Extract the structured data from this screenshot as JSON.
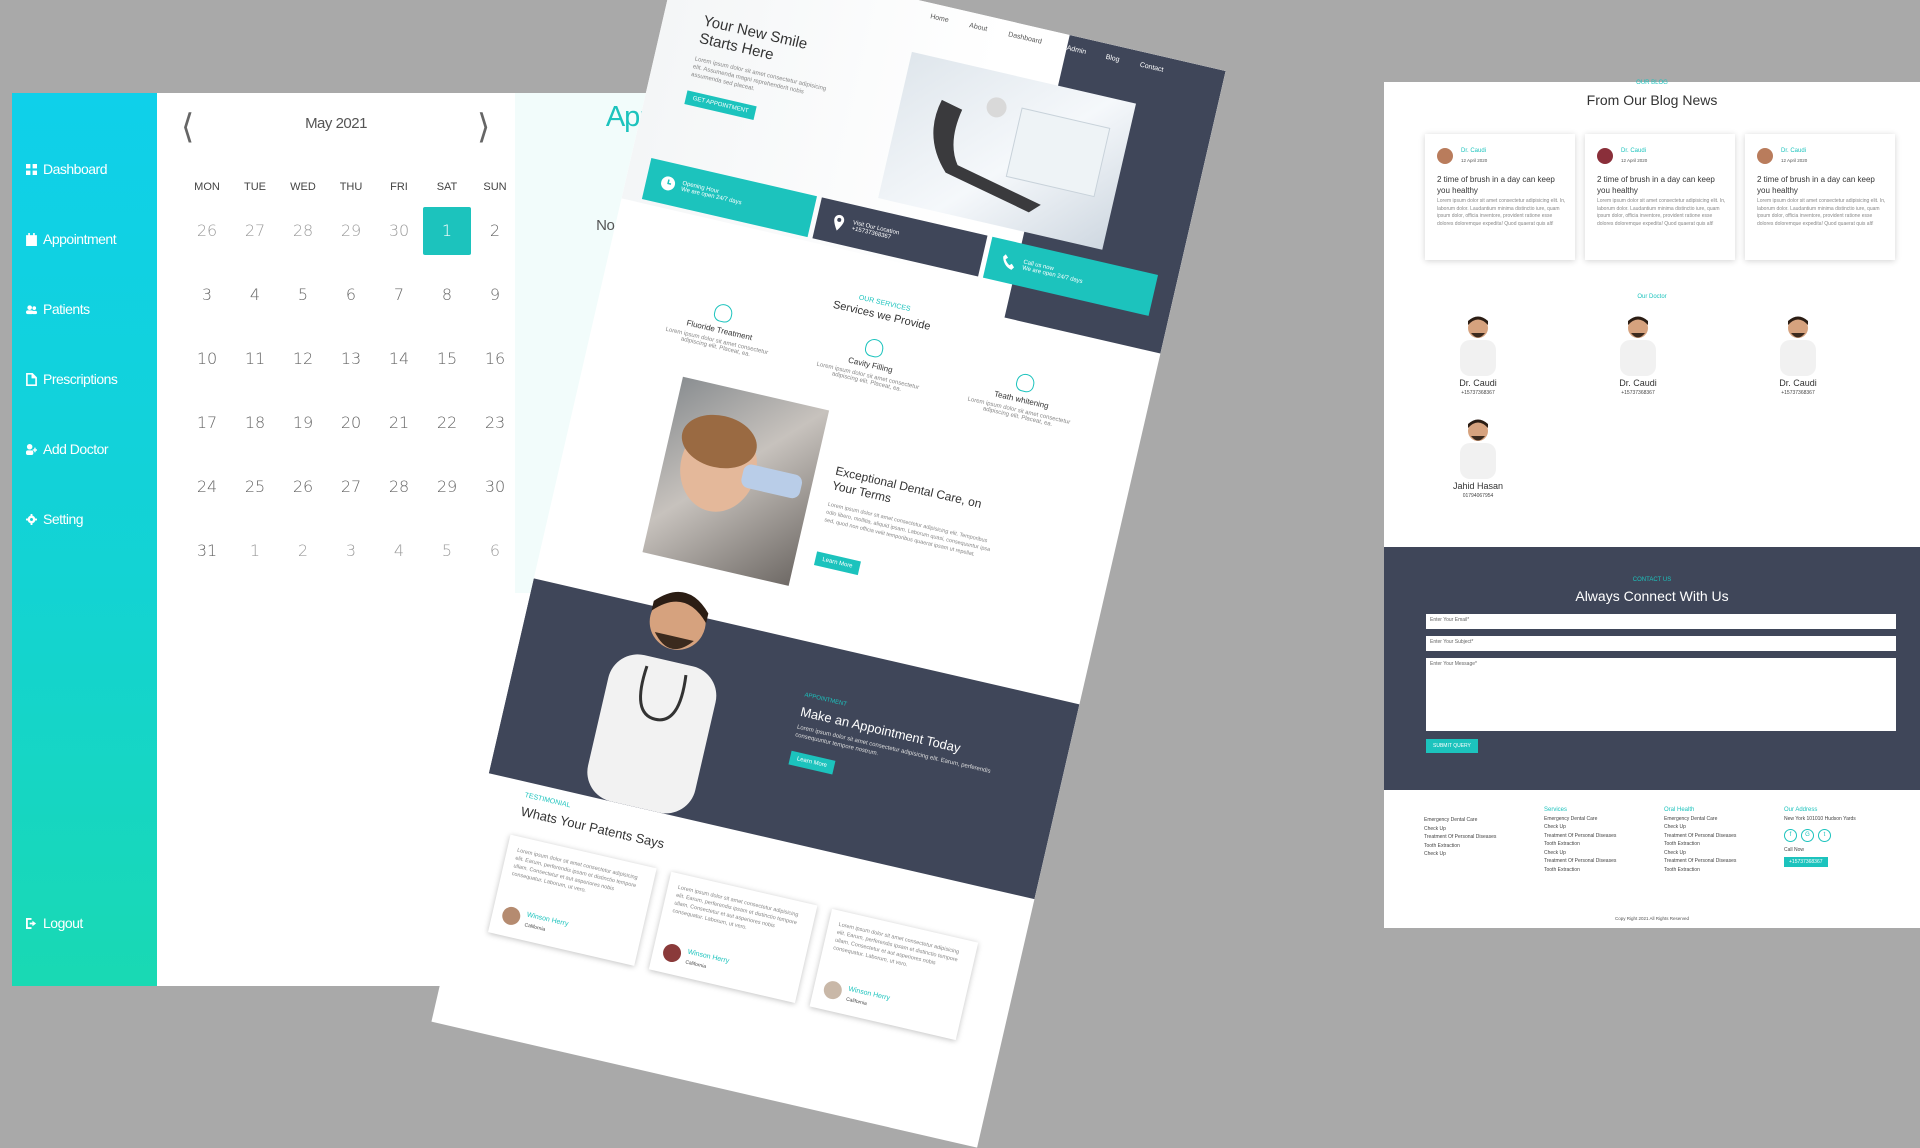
{
  "dashboard": {
    "sidebar": {
      "items": [
        {
          "label": "Dashboard",
          "icon": "grid-icon"
        },
        {
          "label": "Appointment",
          "icon": "calendar-icon"
        },
        {
          "label": "Patients",
          "icon": "users-icon"
        },
        {
          "label": "Prescriptions",
          "icon": "file-icon"
        },
        {
          "label": "Add Doctor",
          "icon": "user-plus-icon"
        },
        {
          "label": "Setting",
          "icon": "gear-icon"
        }
      ],
      "logout": "Logout"
    },
    "calendar": {
      "month": "May 2021",
      "prev": "⟨",
      "next": "⟩",
      "weekdays": [
        "MON",
        "TUE",
        "WED",
        "THU",
        "FRI",
        "SAT",
        "SUN"
      ],
      "weeks": [
        [
          "26",
          "27",
          "28",
          "29",
          "30",
          "1",
          "2"
        ],
        [
          "3",
          "4",
          "5",
          "6",
          "7",
          "8",
          "9"
        ],
        [
          "10",
          "11",
          "12",
          "13",
          "14",
          "15",
          "16"
        ],
        [
          "17",
          "18",
          "19",
          "20",
          "21",
          "22",
          "23"
        ],
        [
          "24",
          "25",
          "26",
          "27",
          "28",
          "29",
          "30"
        ],
        [
          "31",
          "1",
          "2",
          "3",
          "4",
          "5",
          "6"
        ]
      ],
      "selected": "1"
    },
    "appointments": {
      "title": "Appointments",
      "empty": "No Appointments for this Date"
    }
  },
  "landing": {
    "nav": [
      "Home",
      "About",
      "Dashboard",
      "Admin",
      "Blog",
      "Contact"
    ],
    "hero": {
      "title": "Your New Smile Starts Here",
      "text": "Lorem ipsum dolor sit amet consectetur adipisicing elit. Assumenda magni reprehenderit nobis assumenda sed placeat.",
      "button": "GET APPOINTMENT"
    },
    "info": [
      {
        "title": "Opening Hour",
        "sub": "We are open 24/7 days"
      },
      {
        "title": "Visit Our Location",
        "sub": "+15737368367"
      },
      {
        "title": "Call us now",
        "sub": "We are open 24/7 days"
      }
    ],
    "services": {
      "kicker": "OUR SERVICES",
      "title": "Services we Provide",
      "items": [
        {
          "name": "Fluoride Treatment",
          "desc": "Lorem ipsum dolor sit amet consectetur adipiscing elit. Placeat, ea."
        },
        {
          "name": "Cavity Filling",
          "desc": "Lorem ipsum dolor sit amet consectetur adipiscing elit. Placeat, ea."
        },
        {
          "name": "Teath whitening",
          "desc": "Lorem ipsum dolor sit amet consectetur adipiscing elit. Placeat, ea."
        }
      ]
    },
    "feature": {
      "title": "Exceptional Dental Care, on Your Terms",
      "text": "Lorem ipsum dolor sit amet consectetur adipisicing elit. Temporibus odio libero, mollitia, aliquid ipsam. Laborum quasi, consequuntur ipsa sed, quod non officia velit temporibus quaerat ipsam ut repellat.",
      "button": "Learn More"
    },
    "appointment": {
      "kicker": "APPOINTMENT",
      "title": "Make an Appointment Today",
      "text": "Lorem ipsum dolor sit amet consectetur adipisicing elit. Earum, perferendis consequuntur tempore nostrum.",
      "button": "Learn More"
    },
    "testimonial": {
      "kicker": "TESTIMONIAL",
      "title": "Whats Your Patents Says",
      "items": [
        {
          "text": "Lorem ipsum dolor sit amet consectetur adipisicing elit. Earum, perferendis ipsam et distinctio tempore ullam. Consectetur et aut asperiores nobis consequatur. Laborum, ut vero.",
          "name": "Winson Herry",
          "loc": "California"
        },
        {
          "text": "Lorem ipsum dolor sit amet consectetur adipisicing elit. Earum, perferendis ipsam et distinctio tempore ullam. Consectetur et aut asperiores nobis consequatur. Laborum, ut vero.",
          "name": "Winson Herry",
          "loc": "California"
        },
        {
          "text": "Lorem ipsum dolor sit amet consectetur adipisicing elit. Earum, perferendis ipsam et distinctio tempore ullam. Consectetur et aut asperiores nobis consequatur. Laborum, ut vero.",
          "name": "Winson Herry",
          "loc": "California"
        }
      ]
    }
  },
  "site": {
    "blog": {
      "kicker": "OUR BLOG",
      "title": "From Our Blog News",
      "posts": [
        {
          "author": "Dr. Caudi",
          "date": "12 April 2020",
          "title": "2 time of brush in a day can keep you healthy",
          "body": "Lorem ipsum dolor sit amet consectetur adipisicing elit. In, laborum dolor. Laudantium minima distinctio iure, quam ipsum dolor, officia inventore, provident ratione esse dolores doloremque expedita! Quod quaerat quis alt!"
        },
        {
          "author": "Dr. Caudi",
          "date": "12 April 2020",
          "title": "2 time of brush in a day can keep you healthy",
          "body": "Lorem ipsum dolor sit amet consectetur adipisicing elit. In, laborum dolor. Laudantium minima distinctio iure, quam ipsum dolor, officia inventore, provident ratione esse dolores doloremque expedita! Quod quaerat quis alt!"
        },
        {
          "author": "Dr. Caudi",
          "date": "12 April 2020",
          "title": "2 time of brush in a day can keep you healthy",
          "body": "Lorem ipsum dolor sit amet consectetur adipisicing elit. In, laborum dolor. Laudantium minima distinctio iure, quam ipsum dolor, officia inventore, provident ratione esse dolores doloremque expedita! Quod quaerat quis alt!"
        }
      ]
    },
    "doctors": {
      "kicker": "Our Doctor",
      "items": [
        {
          "name": "Dr. Caudi",
          "phone": "+15737368367"
        },
        {
          "name": "Dr. Caudi",
          "phone": "+15737368367"
        },
        {
          "name": "Dr. Caudi",
          "phone": "+15737368367"
        },
        {
          "name": "Jahid Hasan",
          "phone": "01794067954"
        }
      ]
    },
    "contact": {
      "kicker": "CONTACT US",
      "title": "Always Connect With Us",
      "email_ph": "Enter Your Email*",
      "subject_ph": "Enter Your Subject*",
      "message_ph": "Enter Your Message*",
      "submit": "SUBMIT QUERY"
    },
    "footer": {
      "col1": [
        "Emergency Dental Care",
        "Check Up",
        "Treatment Of Personal Diseases",
        "Tooth Extraction",
        "Check Up"
      ],
      "services_title": "Services",
      "services": [
        "Emergency Dental Care",
        "Check Up",
        "Treatment Of Personal Diseases",
        "Tooth Extraction",
        "Check Up",
        "Treatment Of Personal Diseases",
        "Tooth Extraction"
      ],
      "oral_title": "Oral Health",
      "oral": [
        "Emergency Dental Care",
        "Check Up",
        "Treatment Of Personal Diseases",
        "Tooth Extraction",
        "Check Up",
        "Treatment Of Personal Diseases",
        "Tooth Extraction"
      ],
      "address_title": "Our Address",
      "address": "New York 101010 Hudson Yards",
      "social": [
        "f",
        "G",
        "t"
      ],
      "call_label": "Call Now",
      "call_button": "+15737368367",
      "copyright": "Copy Right 2021 All Rights Reserved"
    }
  },
  "colors": {
    "accent": "#1cc3bd",
    "dark": "#3f4659",
    "backdrop": "#a9a9a9"
  }
}
